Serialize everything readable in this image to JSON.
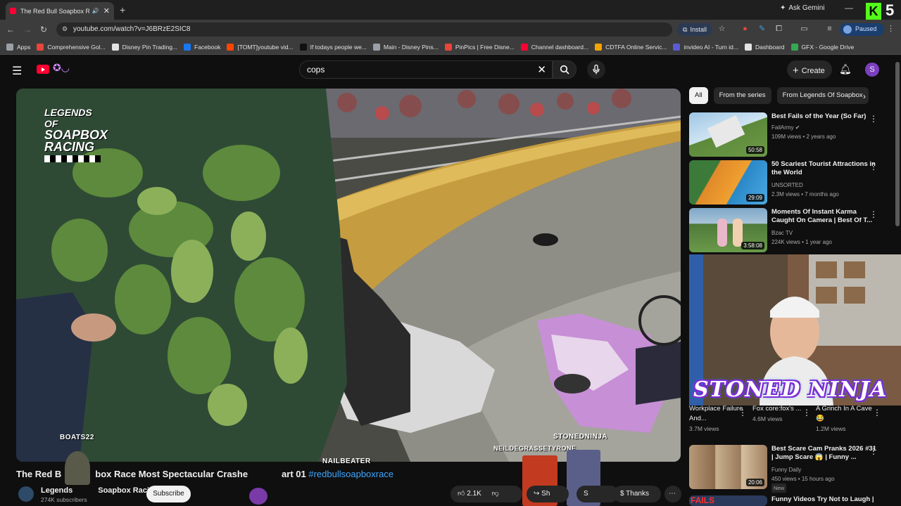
{
  "browser": {
    "tab_title": "The Red Bull Soapbox Race",
    "new_tab": "+",
    "gemini": "Ask Gemini",
    "kick_letter": "K",
    "kick_count": "5",
    "url": "youtube.com/watch?v=J6BRzE2SIC8",
    "install": "Install",
    "paused": "Paused",
    "bookmarks": [
      {
        "label": "Apps",
        "color": "#9aa0a6"
      },
      {
        "label": "Comprehensive Gol...",
        "color": "#e8453c"
      },
      {
        "label": "Disney Pin Trading...",
        "color": "#e3e3e3"
      },
      {
        "label": "Facebook",
        "color": "#1877f2"
      },
      {
        "label": "[TOMT]youtube vid...",
        "color": "#ff4500"
      },
      {
        "label": "If todays people we...",
        "color": "#111111"
      },
      {
        "label": "Main - Disney Pins...",
        "color": "#9aa0a6"
      },
      {
        "label": "PinPics | Free Disne...",
        "color": "#e8453c"
      },
      {
        "label": "Channel dashboard...",
        "color": "#ff0033"
      },
      {
        "label": "CDTFA Online Servic...",
        "color": "#f4a300"
      },
      {
        "label": "invideo AI - Turn id...",
        "color": "#5b5bd6"
      },
      {
        "label": "Dashboard",
        "color": "#e3e3e3"
      },
      {
        "label": "GFX - Google Drive",
        "color": "#34a853"
      }
    ]
  },
  "header": {
    "search_query": "cops",
    "create": "Create",
    "avatar_letter": "S"
  },
  "video": {
    "watermark_line1": "LEGENDS OF",
    "watermark_line2": "SOAPBOX",
    "watermark_line3": "RACING",
    "overlay_names": [
      "BOATS22",
      "STONEDNINJA",
      "NEILDEGRASSETYRONE",
      "NAILBEATER"
    ],
    "title_a": "The Red B",
    "title_b": "box Race Most Spectacular Crashe",
    "title_c": "art 01",
    "hashtag": "#redbullsoapboxrace",
    "channel": "Legends",
    "channel_b": "Soapbox Racing",
    "subscribers": "274K subscribers",
    "subscribe": "Subscribe",
    "likes": "2.1K",
    "share": "Sh",
    "save": "S",
    "thanks": "Thanks"
  },
  "chips": [
    "All",
    "From the series",
    "From Legends Of Soapbox"
  ],
  "recommendations": [
    {
      "title": "Best Fails of the Year (So Far)",
      "channel": "FailArmy",
      "meta": "109M views • 2 years ago",
      "duration": "50:58",
      "verified": true
    },
    {
      "title": "50 Scariest Tourist Attractions in the World",
      "channel": "UNSORTED",
      "meta": "2.3M views • 7 months ago",
      "duration": "29:09"
    },
    {
      "title": "Moments Of Instant Karma Caught On Camera | Best Of T...",
      "channel": "Bzac TV",
      "meta": "224K views • 1 year ago",
      "duration": "3:58:08"
    }
  ],
  "webcam_text": "STONED NINJA",
  "shorts": [
    {
      "title": "Workplace Failure And...",
      "views": "3.7M views"
    },
    {
      "title": "Fox core:fox's ...",
      "views": "4.6M views"
    },
    {
      "title": "A Grinch In A Cave 😂",
      "views": "1.2M views"
    }
  ],
  "recommendations2": [
    {
      "title": "Best Scare Cam Pranks 2026 #31 | Jump Scare 😱 | Funny ...",
      "channel": "Funny Daily",
      "meta": "450 views • 15 hours ago",
      "badge": "New",
      "duration": "20:06"
    },
    {
      "title": "Funny Videos Try Not to Laugh |",
      "thumb_text": "FAILS"
    }
  ]
}
